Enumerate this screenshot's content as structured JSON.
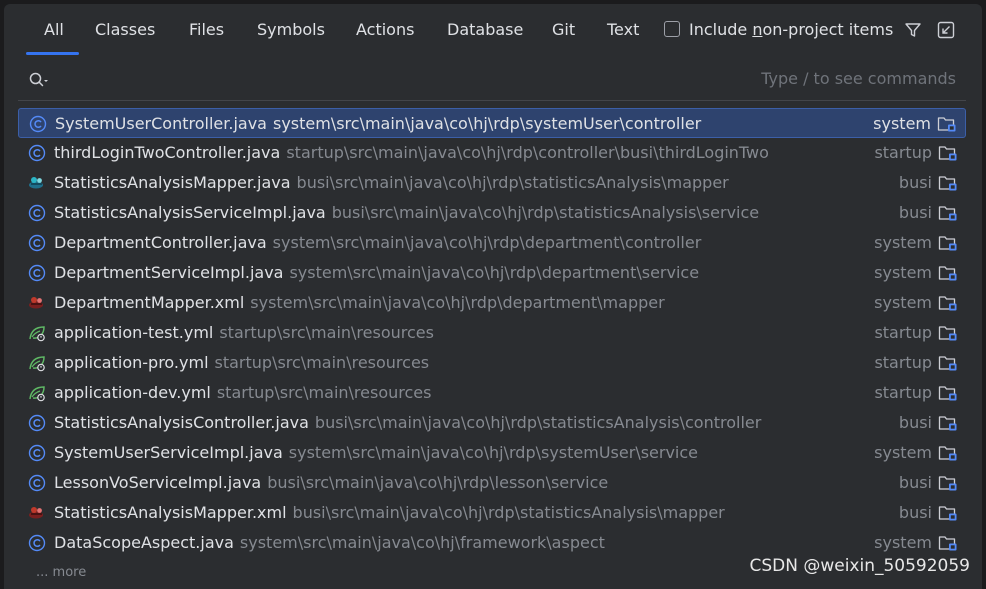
{
  "tabs": [
    {
      "label": "All",
      "selected": true
    },
    {
      "label": "Classes"
    },
    {
      "label": "Files"
    },
    {
      "label": "Symbols"
    },
    {
      "label": "Actions"
    },
    {
      "label": "Database"
    },
    {
      "label": "Git"
    },
    {
      "label": "Text"
    }
  ],
  "checkbox": {
    "label_before": "Include ",
    "mnemonic": "n",
    "label_after": "on-project items",
    "checked": false
  },
  "toolbar_icons": [
    "filter-icon",
    "pin-window-icon"
  ],
  "search": {
    "value": "",
    "hint": "Type / to see commands",
    "icon": "search-icon"
  },
  "colors": {
    "accent": "#3574f0",
    "selected_row": "#2e436e",
    "class_icon": "#548af7",
    "spring_icon": "#5fb865"
  },
  "results": [
    {
      "name": "SystemUserController.java",
      "path": "system\\src\\main\\java\\co\\hj\\rdp\\systemUser\\controller",
      "module": "system",
      "icon": "java-class-icon",
      "selected": true
    },
    {
      "name": "thirdLoginTwoController.java",
      "path": "startup\\src\\main\\java\\co\\hj\\rdp\\controller\\busi\\thirdLoginTwo",
      "module": "startup",
      "icon": "java-class-icon"
    },
    {
      "name": "StatisticsAnalysisMapper.java",
      "path": "busi\\src\\main\\java\\co\\hj\\rdp\\statisticsAnalysis\\mapper",
      "module": "busi",
      "icon": "mybatis-mapper-icon"
    },
    {
      "name": "StatisticsAnalysisServiceImpl.java",
      "path": "busi\\src\\main\\java\\co\\hj\\rdp\\statisticsAnalysis\\service",
      "module": "busi",
      "icon": "java-class-icon"
    },
    {
      "name": "DepartmentController.java",
      "path": "system\\src\\main\\java\\co\\hj\\rdp\\department\\controller",
      "module": "system",
      "icon": "java-class-icon"
    },
    {
      "name": "DepartmentServiceImpl.java",
      "path": "system\\src\\main\\java\\co\\hj\\rdp\\department\\service",
      "module": "system",
      "icon": "java-class-icon"
    },
    {
      "name": "DepartmentMapper.xml",
      "path": "system\\src\\main\\java\\co\\hj\\rdp\\department\\mapper",
      "module": "system",
      "icon": "mybatis-xml-icon"
    },
    {
      "name": "application-test.yml",
      "path": "startup\\src\\main\\resources",
      "module": "startup",
      "icon": "spring-config-icon"
    },
    {
      "name": "application-pro.yml",
      "path": "startup\\src\\main\\resources",
      "module": "startup",
      "icon": "spring-config-icon"
    },
    {
      "name": "application-dev.yml",
      "path": "startup\\src\\main\\resources",
      "module": "startup",
      "icon": "spring-config-icon"
    },
    {
      "name": "StatisticsAnalysisController.java",
      "path": "busi\\src\\main\\java\\co\\hj\\rdp\\statisticsAnalysis\\controller",
      "module": "busi",
      "icon": "java-class-icon"
    },
    {
      "name": "SystemUserServiceImpl.java",
      "path": "system\\src\\main\\java\\co\\hj\\rdp\\systemUser\\service",
      "module": "system",
      "icon": "java-class-icon"
    },
    {
      "name": "LessonVoServiceImpl.java",
      "path": "busi\\src\\main\\java\\co\\hj\\rdp\\lesson\\service",
      "module": "busi",
      "icon": "java-class-icon"
    },
    {
      "name": "StatisticsAnalysisMapper.xml",
      "path": "busi\\src\\main\\java\\co\\hj\\rdp\\statisticsAnalysis\\mapper",
      "module": "busi",
      "icon": "mybatis-xml-icon"
    },
    {
      "name": "DataScopeAspect.java",
      "path": "system\\src\\main\\java\\co\\hj\\framework\\aspect",
      "module": "system",
      "icon": "java-class-icon"
    }
  ],
  "more_label": "... more",
  "watermark": "CSDN @weixin_50592059"
}
